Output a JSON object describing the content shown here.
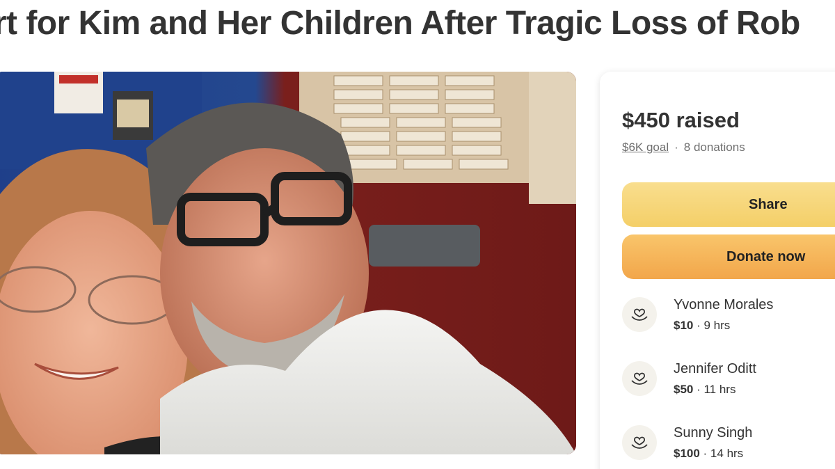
{
  "campaign": {
    "title": "ort for Kim and Her Children After Tragic Loss of Rob"
  },
  "progress": {
    "raised": "$450 raised",
    "goal": "$6K goal",
    "separator": "·",
    "donations": "8 donations",
    "raised_fraction": 0.075
  },
  "actions": {
    "share_label": "Share",
    "donate_label": "Donate now"
  },
  "donors": [
    {
      "name": "Yvonne Morales",
      "amount": "$10",
      "time": " · 9 hrs"
    },
    {
      "name": "Jennifer Oditt",
      "amount": "$50",
      "time": " · 11 hrs"
    },
    {
      "name": "Sunny Singh",
      "amount": "$100",
      "time": " · 14 hrs"
    }
  ],
  "icons": {
    "donor": "heart-hands-icon"
  },
  "colors": {
    "share_button": "#f4cf68",
    "donate_button": "#f2a64a",
    "text": "#333333",
    "muted": "#6f6f6f"
  }
}
